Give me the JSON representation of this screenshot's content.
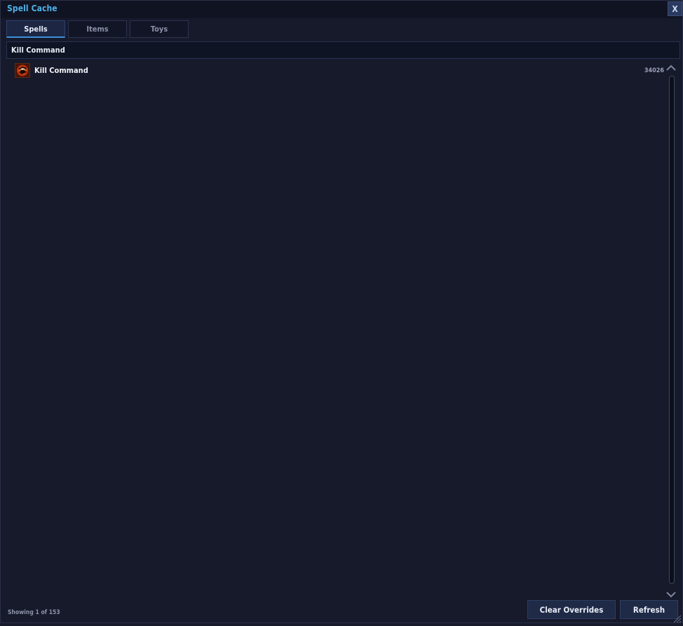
{
  "window": {
    "title": "Spell Cache",
    "close_label": "X"
  },
  "tabs": [
    {
      "label": "Spells",
      "active": true
    },
    {
      "label": "Items",
      "active": false
    },
    {
      "label": "Toys",
      "active": false
    }
  ],
  "search": {
    "value": "Kill Command"
  },
  "results": [
    {
      "name": "Kill Command",
      "id": "34026",
      "icon": "kill-command-spell-icon"
    }
  ],
  "status": {
    "text": "Showing 1 of 153"
  },
  "footer": {
    "clear_label": "Clear Overrides",
    "refresh_label": "Refresh"
  },
  "colors": {
    "background": "#171a2b",
    "accent": "#4fb0e6",
    "button": "#1e2a46"
  }
}
